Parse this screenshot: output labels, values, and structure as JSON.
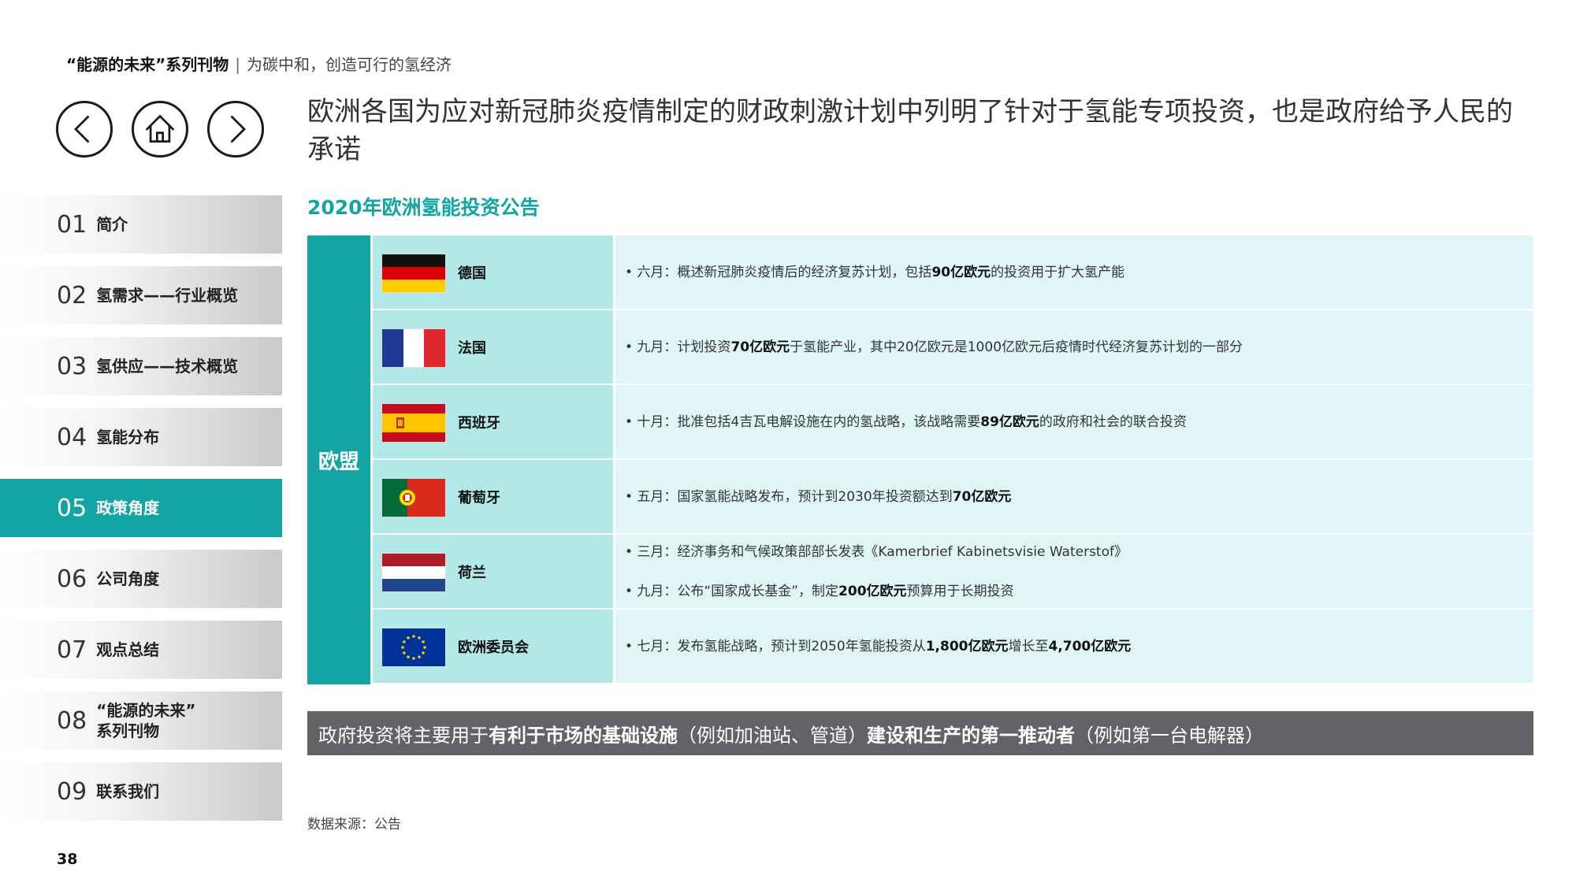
{
  "header": {
    "series": "“能源的未来”系列刊物",
    "separator": "|",
    "subtitle": "为碳中和，创造可行的氢经济"
  },
  "nav": {
    "back_icon": "chevron-left-icon",
    "home_icon": "home-icon",
    "next_icon": "chevron-right-icon"
  },
  "page_title": "欧洲各国为应对新冠肺炎疫情制定的财政刺激计划中列明了针对于氢能专项投资，也是政府给予人民的承诺",
  "sidebar": {
    "items": [
      {
        "num": "01",
        "label": "简介",
        "active": false
      },
      {
        "num": "02",
        "label": "氢需求——行业概览",
        "active": false
      },
      {
        "num": "03",
        "label": "氢供应——技术概览",
        "active": false
      },
      {
        "num": "04",
        "label": "氢能分布",
        "active": false
      },
      {
        "num": "05",
        "label": "政策角度",
        "active": true
      },
      {
        "num": "06",
        "label": "公司角度",
        "active": false
      },
      {
        "num": "07",
        "label": "观点总结",
        "active": false
      },
      {
        "num": "08",
        "label": "“能源的未来”\n系列刊物",
        "active": false
      },
      {
        "num": "09",
        "label": "联系我们",
        "active": false
      }
    ]
  },
  "section_title": "2020年欧洲氢能投资公告",
  "table": {
    "region": "欧盟",
    "rows": [
      {
        "flag": "germany-flag",
        "country": "德国",
        "notes": [
          [
            {
              "t": "• 六月：概述新冠肺炎疫情后的经济复苏计划，包括"
            },
            {
              "t": "90亿欧元",
              "b": true
            },
            {
              "t": "的投资用于扩大氢产能"
            }
          ]
        ]
      },
      {
        "flag": "france-flag",
        "country": "法国",
        "notes": [
          [
            {
              "t": "• 九月：计划投资"
            },
            {
              "t": "70亿欧元",
              "b": true
            },
            {
              "t": "于氢能产业，其中20亿欧元是1000亿欧元后疫情时代经济复苏计划的一部分"
            }
          ]
        ]
      },
      {
        "flag": "spain-flag",
        "country": "西班牙",
        "notes": [
          [
            {
              "t": "• 十月：批准包括4吉瓦电解设施在内的氢战略，该战略需要"
            },
            {
              "t": "89亿欧元",
              "b": true
            },
            {
              "t": "的政府和社会的联合投资"
            }
          ]
        ]
      },
      {
        "flag": "portugal-flag",
        "country": "葡萄牙",
        "notes": [
          [
            {
              "t": "• 五月：国家氢能战略发布，预计到2030年投资额达到"
            },
            {
              "t": "70亿欧元",
              "b": true
            }
          ]
        ]
      },
      {
        "flag": "netherlands-flag",
        "country": "荷兰",
        "notes": [
          [
            {
              "t": "• 三月：经济事务和气候政策部部长发表《Kamerbrief Kabinetsvisie Waterstof》"
            }
          ],
          [
            {
              "t": "• 九月：公布“国家成长基金”，制定"
            },
            {
              "t": "200亿欧元",
              "b": true
            },
            {
              "t": "预算用于长期投资"
            }
          ]
        ]
      },
      {
        "flag": "eu-flag",
        "country": "欧洲委员会",
        "notes": [
          [
            {
              "t": "• 七月：发布氢能战略，预计到2050年氢能投资从"
            },
            {
              "t": "1,800亿欧元",
              "b": true
            },
            {
              "t": "增长至"
            },
            {
              "t": "4,700亿欧元",
              "b": true
            }
          ]
        ]
      }
    ]
  },
  "banner": [
    {
      "t": "政府投资将主要用于"
    },
    {
      "t": "有利于市场的基础设施",
      "b": true
    },
    {
      "t": "（例如加油站、管道）"
    },
    {
      "t": "建设和生产的第一推动者",
      "b": true
    },
    {
      "t": "（例如第一台电解器）"
    }
  ],
  "source": "数据来源：公告",
  "page_number": "38",
  "colors": {
    "accent": "#12a5a3",
    "country_cell": "#b2e9e8",
    "detail_cell": "#e0f6f6",
    "banner": "#616366"
  }
}
